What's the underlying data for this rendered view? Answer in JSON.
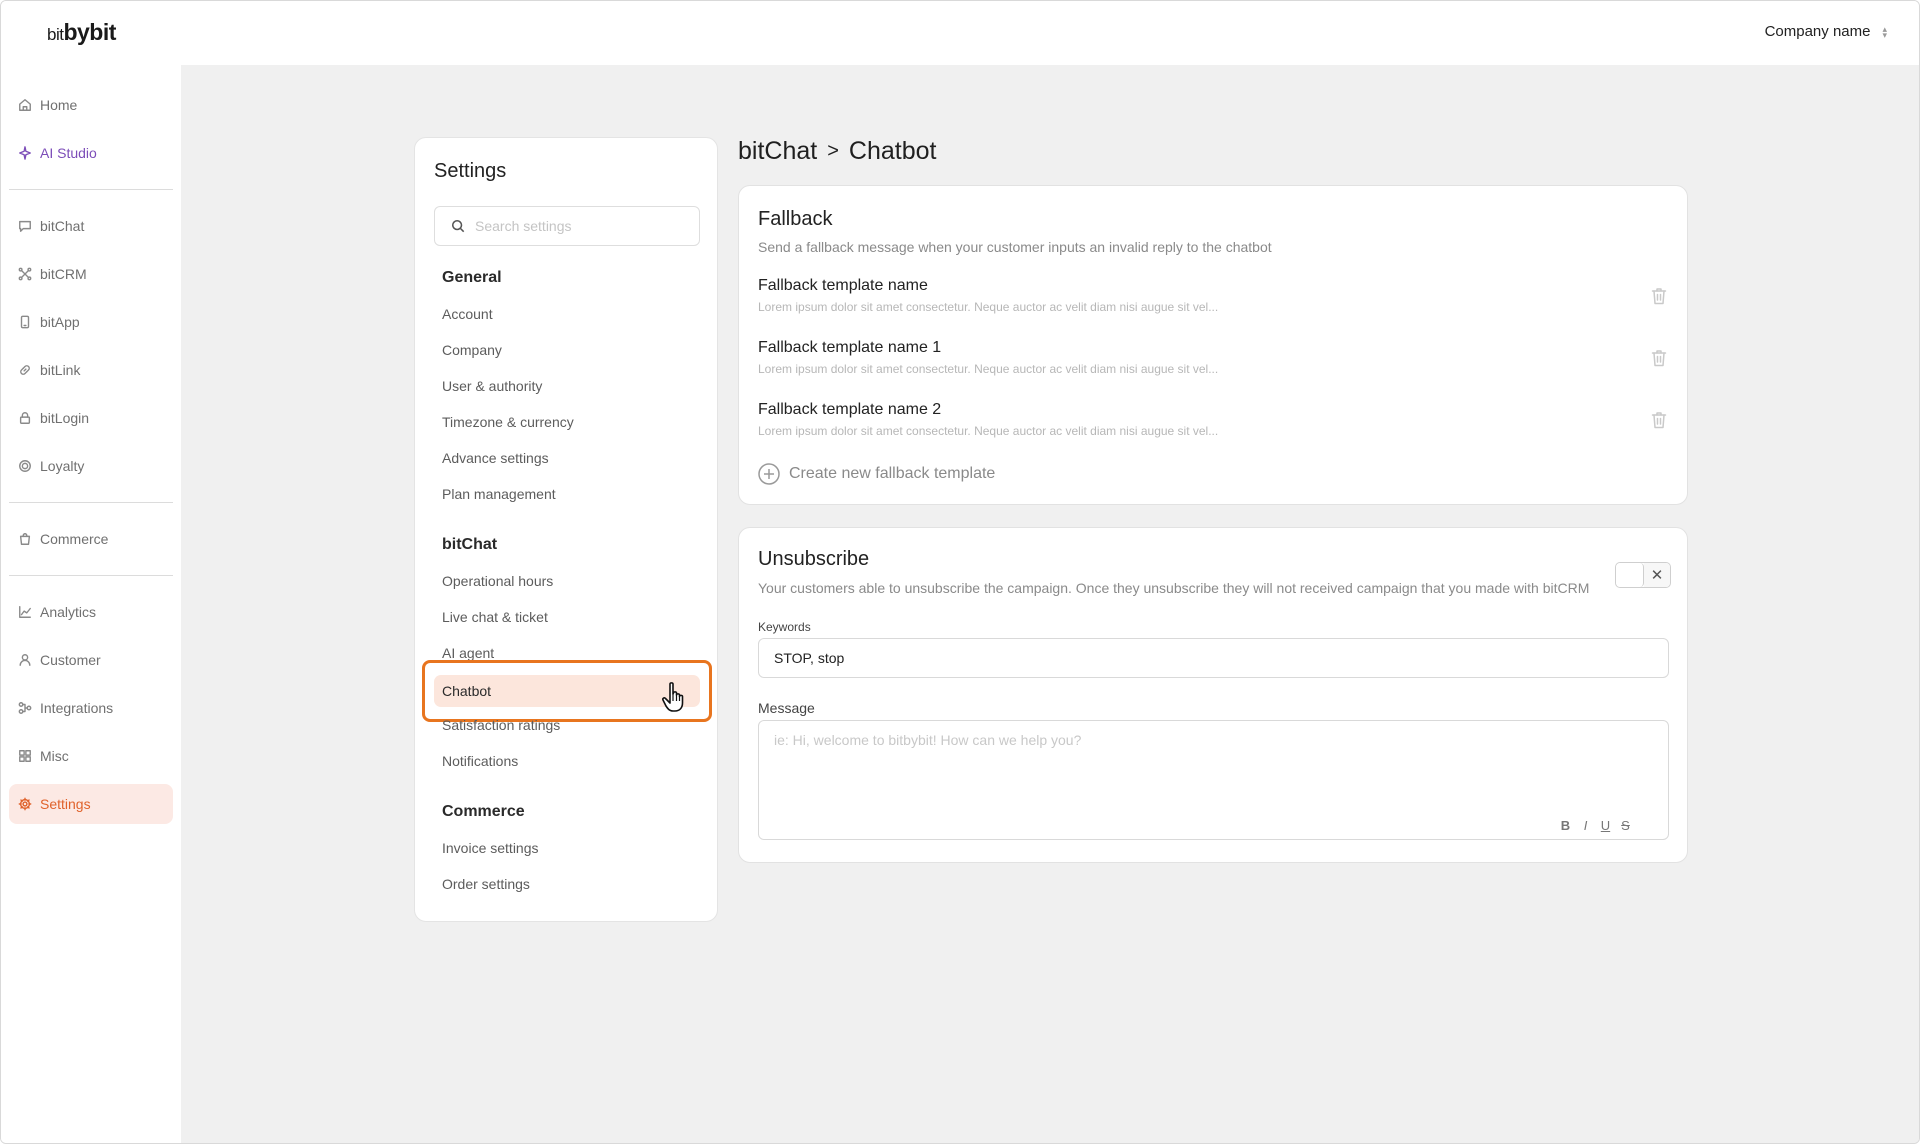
{
  "app": {
    "logo_prefix": "bit",
    "logo_main": "bybit",
    "company_selector": "Company name"
  },
  "sidebar": {
    "items": [
      {
        "label": "Home",
        "icon": "home-icon"
      },
      {
        "label": "AI Studio",
        "icon": "sparkle-icon"
      },
      {
        "label": "bitChat",
        "icon": "chat-icon"
      },
      {
        "label": "bitCRM",
        "icon": "network-icon"
      },
      {
        "label": "bitApp",
        "icon": "phone-icon"
      },
      {
        "label": "bitLink",
        "icon": "link-icon"
      },
      {
        "label": "bitLogin",
        "icon": "lock-icon"
      },
      {
        "label": "Loyalty",
        "icon": "badge-icon"
      },
      {
        "label": "Commerce",
        "icon": "bag-icon"
      },
      {
        "label": "Analytics",
        "icon": "chart-icon"
      },
      {
        "label": "Customer",
        "icon": "user-icon"
      },
      {
        "label": "Integrations",
        "icon": "integration-icon"
      },
      {
        "label": "Misc",
        "icon": "grid-icon"
      },
      {
        "label": "Settings",
        "icon": "gear-icon"
      }
    ],
    "active": "Settings"
  },
  "settings_panel": {
    "title": "Settings",
    "search_placeholder": "Search settings",
    "sections": [
      {
        "heading": "General",
        "items": [
          "Account",
          "Company",
          "User & authority",
          "Timezone & currency",
          "Advance settings",
          "Plan management"
        ]
      },
      {
        "heading": "bitChat",
        "items": [
          "Operational hours",
          "Live chat & ticket",
          "AI agent",
          "Chatbot",
          "Satisfaction ratings",
          "Notifications"
        ]
      },
      {
        "heading": "Commerce",
        "items": [
          "Invoice settings",
          "Order settings"
        ]
      }
    ],
    "active_item": "Chatbot"
  },
  "breadcrumb": {
    "parent": "bitChat",
    "separator": ">",
    "current": "Chatbot"
  },
  "fallback": {
    "title": "Fallback",
    "description": "Send a fallback message when your customer inputs an invalid reply to the chatbot",
    "templates": [
      {
        "name": "Fallback template name",
        "preview": "Lorem ipsum dolor sit amet consectetur. Neque auctor ac velit diam nisi augue sit vel..."
      },
      {
        "name": "Fallback template name 1",
        "preview": "Lorem ipsum dolor sit amet consectetur. Neque auctor ac velit diam nisi augue sit vel..."
      },
      {
        "name": "Fallback template name 2",
        "preview": "Lorem ipsum dolor sit amet consectetur. Neque auctor ac velit diam nisi augue sit vel..."
      }
    ],
    "create_label": "Create new fallback template"
  },
  "unsubscribe": {
    "title": "Unsubscribe",
    "description": "Your customers able to unsubscribe the campaign. Once they unsubscribe they will not received campaign that you made with bitCRM",
    "toggle_off_symbol": "✕",
    "keywords_label": "Keywords",
    "keywords_value": "STOP, stop",
    "message_label": "Message",
    "message_placeholder": "ie: Hi, welcome to bitbybit! How can we help you?",
    "format_buttons": [
      "B",
      "I",
      "U",
      "S"
    ]
  },
  "colors": {
    "accent": "#e0622b",
    "highlight_ring": "#e8751f",
    "active_bg": "#fce6dc",
    "ai_purple": "#7c4db8",
    "main_bg": "#f0f0f0"
  }
}
